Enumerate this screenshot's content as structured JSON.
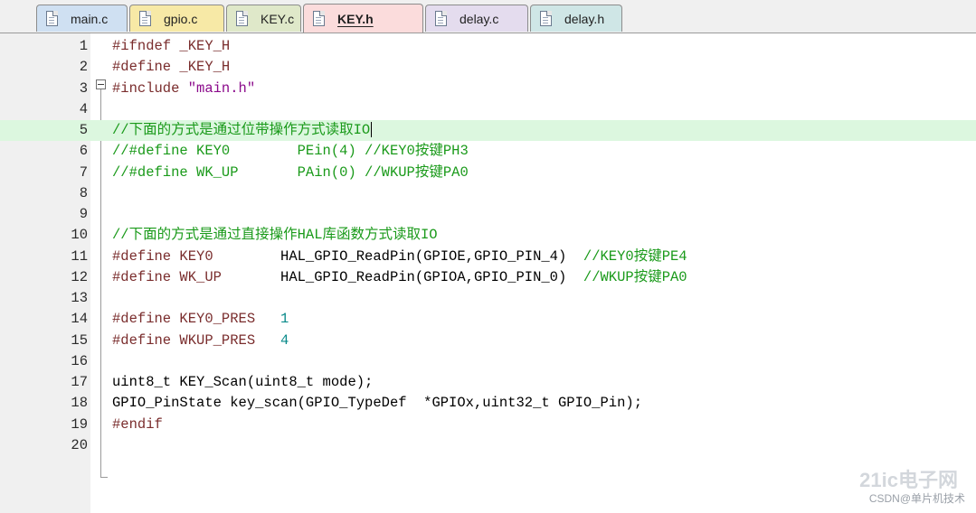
{
  "tabs": [
    {
      "label": "main.c",
      "color": "#cfe0f2"
    },
    {
      "label": "gpio.c",
      "color": "#f7e9a6"
    },
    {
      "label": "KEY.c",
      "color": "#dfe8c9"
    },
    {
      "label": "KEY.h",
      "color": "#fbdcdc",
      "active": true
    },
    {
      "label": "delay.c",
      "color": "#e4dcee"
    },
    {
      "label": "delay.h",
      "color": "#cfe6e6"
    }
  ],
  "lines": [
    {
      "n": "1",
      "segs": [
        {
          "t": "#ifndef _KEY_H",
          "c": "pre"
        }
      ]
    },
    {
      "n": "2",
      "segs": [
        {
          "t": "#define _KEY_H",
          "c": "pre"
        }
      ]
    },
    {
      "n": "3",
      "segs": [
        {
          "t": "#include ",
          "c": "pre"
        },
        {
          "t": "\"main.h\"",
          "c": "str"
        }
      ]
    },
    {
      "n": "4",
      "segs": []
    },
    {
      "n": "5",
      "segs": [
        {
          "t": "//下面的方式是通过位带操作方式读取IO",
          "c": "green"
        }
      ]
    },
    {
      "n": "6",
      "segs": [
        {
          "t": "//#define KEY0        PEin(4) //KEY0按键PH3",
          "c": "green"
        }
      ]
    },
    {
      "n": "7",
      "segs": [
        {
          "t": "//#define WK_UP       PAin(0) //WKUP按键PA0",
          "c": "green"
        }
      ]
    },
    {
      "n": "8",
      "segs": []
    },
    {
      "n": "9",
      "segs": []
    },
    {
      "n": "10",
      "segs": [
        {
          "t": "//下面的方式是通过直接操作HAL库函数方式读取IO",
          "c": "green"
        }
      ]
    },
    {
      "n": "11",
      "segs": [
        {
          "t": "#define KEY0        ",
          "c": "pre"
        },
        {
          "t": "HAL_GPIO_ReadPin(GPIOE,GPIO_PIN_4)  ",
          "c": "plain"
        },
        {
          "t": "//KEY0按键PE4",
          "c": "green"
        }
      ]
    },
    {
      "n": "12",
      "segs": [
        {
          "t": "#define WK_UP       ",
          "c": "pre"
        },
        {
          "t": "HAL_GPIO_ReadPin(GPIOA,GPIO_PIN_0)  ",
          "c": "plain"
        },
        {
          "t": "//WKUP按键PA0",
          "c": "green"
        }
      ]
    },
    {
      "n": "13",
      "segs": []
    },
    {
      "n": "14",
      "segs": [
        {
          "t": "#define KEY0_PRES   ",
          "c": "pre"
        },
        {
          "t": "1",
          "c": "num"
        }
      ]
    },
    {
      "n": "15",
      "segs": [
        {
          "t": "#define WKUP_PRES   ",
          "c": "pre"
        },
        {
          "t": "4",
          "c": "num"
        }
      ]
    },
    {
      "n": "16",
      "segs": []
    },
    {
      "n": "17",
      "segs": [
        {
          "t": "uint8_t KEY_Scan(uint8_t mode);",
          "c": "plain"
        }
      ]
    },
    {
      "n": "18",
      "segs": [
        {
          "t": "GPIO_PinState key_scan(GPIO_TypeDef  *GPIOx,uint32_t GPIO_Pin);",
          "c": "plain"
        }
      ]
    },
    {
      "n": "19",
      "segs": [
        {
          "t": "#endif",
          "c": "pre"
        }
      ]
    },
    {
      "n": "20",
      "segs": []
    }
  ],
  "highlight_line": "5",
  "watermark": {
    "logo": "21ic电子网",
    "text": "CSDN@单片机技术"
  }
}
